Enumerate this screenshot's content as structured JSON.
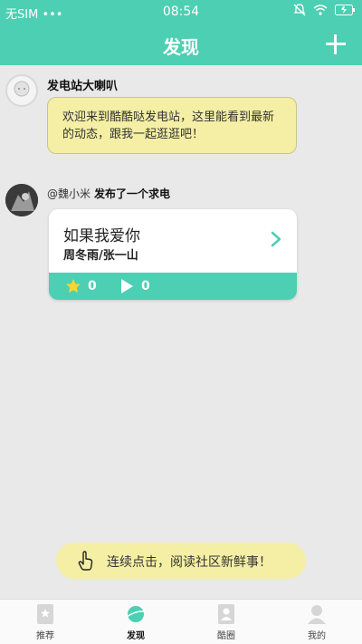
{
  "status_bar": {
    "carrier": "无SIM",
    "dots": "•••",
    "time": "08:54",
    "battery": ""
  },
  "header": {
    "title": "发现"
  },
  "feed": [
    {
      "name": "发电站大喇叭",
      "message": "欢迎来到酷酷哒发电站，这里能看到最新的动态，跟我一起逛逛吧！"
    },
    {
      "user": "@魏小米",
      "action": "发布了一个求电",
      "card": {
        "song": "如果我爱你",
        "artist": "周冬雨/张一山",
        "stars": "0",
        "plays": "0"
      }
    }
  ],
  "hint": {
    "text": "连续点击，阅读社区新鲜事！"
  },
  "tabbar": {
    "items": [
      {
        "label": "推荐"
      },
      {
        "label": "发现"
      },
      {
        "label": "酷圈"
      },
      {
        "label": "我的"
      }
    ]
  },
  "colors": {
    "accent": "#4ccfb2",
    "bubble": "#f4efa4"
  }
}
